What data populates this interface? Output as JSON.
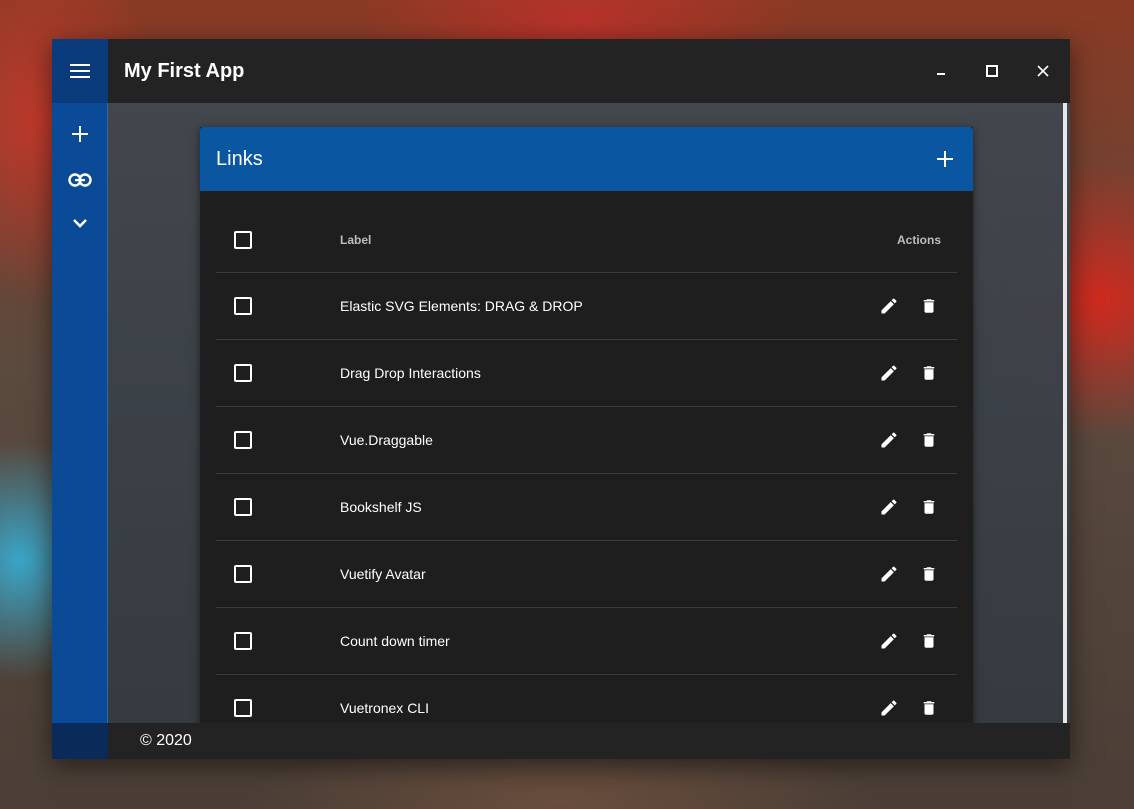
{
  "window": {
    "title": "My First App",
    "footer": "© 2020"
  },
  "sidebar": {
    "items": [
      {
        "icon": "menu-icon"
      },
      {
        "icon": "plus-icon"
      },
      {
        "icon": "link-icon"
      },
      {
        "icon": "chevron-down-icon"
      }
    ],
    "color": "#0b4a96"
  },
  "card": {
    "title": "Links",
    "header_color": "#0a56a0",
    "columns": {
      "label": "Label",
      "actions": "Actions"
    },
    "rows": [
      {
        "label": "Elastic SVG Elements: DRAG & DROP"
      },
      {
        "label": "Drag Drop Interactions"
      },
      {
        "label": "Vue.Draggable"
      },
      {
        "label": "Bookshelf JS"
      },
      {
        "label": "Vuetify Avatar"
      },
      {
        "label": "Count down timer"
      },
      {
        "label": "Vuetronex CLI"
      }
    ]
  }
}
